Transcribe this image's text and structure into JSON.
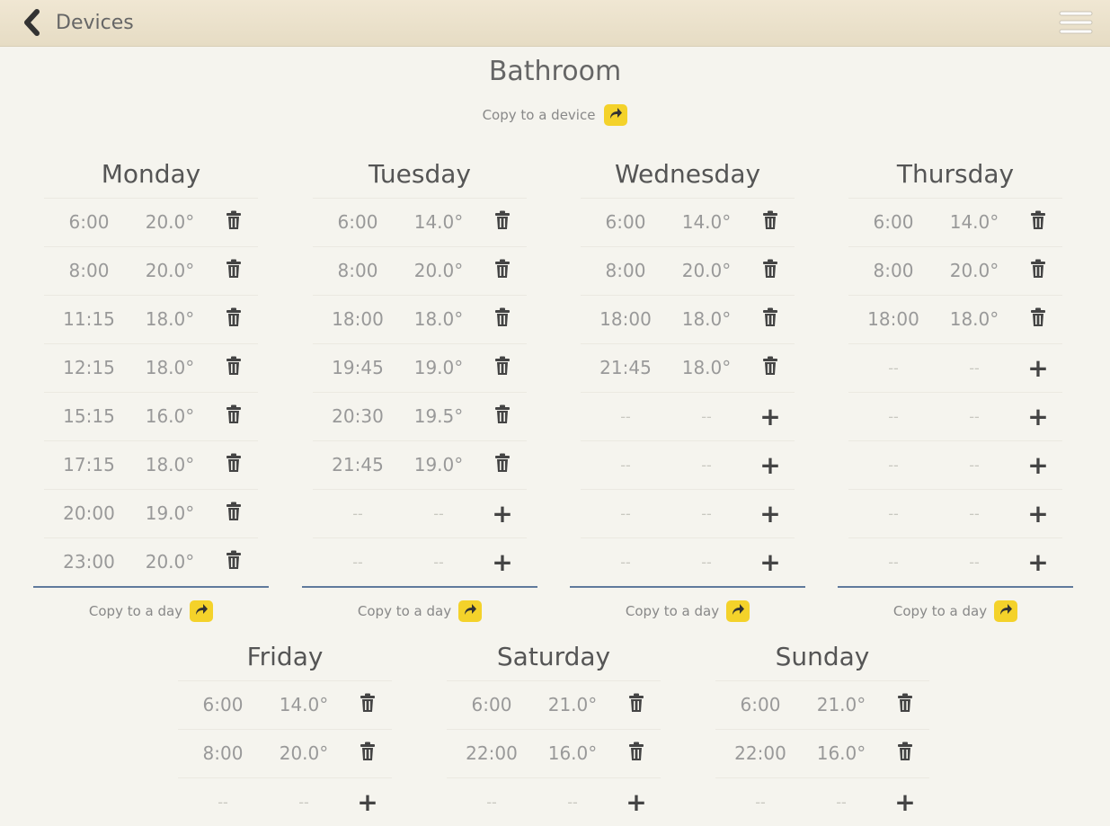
{
  "header": {
    "back_label": "Devices"
  },
  "device": {
    "title": "Bathroom",
    "copy_label": "Copy to a device"
  },
  "copy_day_label": "Copy to a day",
  "empty_placeholder": "--",
  "colors": {
    "accent": "#f4d22a",
    "underline": "#5f7a9c",
    "topbar": "#ece2cc"
  },
  "days": [
    {
      "name": "Monday",
      "slots": [
        {
          "time": "6:00",
          "temp": "20.0°"
        },
        {
          "time": "8:00",
          "temp": "20.0°"
        },
        {
          "time": "11:15",
          "temp": "18.0°"
        },
        {
          "time": "12:15",
          "temp": "18.0°"
        },
        {
          "time": "15:15",
          "temp": "16.0°"
        },
        {
          "time": "17:15",
          "temp": "18.0°"
        },
        {
          "time": "20:00",
          "temp": "19.0°"
        },
        {
          "time": "23:00",
          "temp": "20.0°"
        }
      ]
    },
    {
      "name": "Tuesday",
      "slots": [
        {
          "time": "6:00",
          "temp": "14.0°"
        },
        {
          "time": "8:00",
          "temp": "20.0°"
        },
        {
          "time": "18:00",
          "temp": "18.0°"
        },
        {
          "time": "19:45",
          "temp": "19.0°"
        },
        {
          "time": "20:30",
          "temp": "19.5°"
        },
        {
          "time": "21:45",
          "temp": "19.0°"
        },
        {
          "time": "--",
          "temp": "--"
        },
        {
          "time": "--",
          "temp": "--"
        }
      ]
    },
    {
      "name": "Wednesday",
      "slots": [
        {
          "time": "6:00",
          "temp": "14.0°"
        },
        {
          "time": "8:00",
          "temp": "20.0°"
        },
        {
          "time": "18:00",
          "temp": "18.0°"
        },
        {
          "time": "21:45",
          "temp": "18.0°"
        },
        {
          "time": "--",
          "temp": "--"
        },
        {
          "time": "--",
          "temp": "--"
        },
        {
          "time": "--",
          "temp": "--"
        },
        {
          "time": "--",
          "temp": "--"
        }
      ]
    },
    {
      "name": "Thursday",
      "slots": [
        {
          "time": "6:00",
          "temp": "14.0°"
        },
        {
          "time": "8:00",
          "temp": "20.0°"
        },
        {
          "time": "18:00",
          "temp": "18.0°"
        },
        {
          "time": "--",
          "temp": "--"
        },
        {
          "time": "--",
          "temp": "--"
        },
        {
          "time": "--",
          "temp": "--"
        },
        {
          "time": "--",
          "temp": "--"
        },
        {
          "time": "--",
          "temp": "--"
        }
      ]
    },
    {
      "name": "Friday",
      "slots": [
        {
          "time": "6:00",
          "temp": "14.0°"
        },
        {
          "time": "8:00",
          "temp": "20.0°"
        },
        {
          "time": "--",
          "temp": "--"
        }
      ]
    },
    {
      "name": "Saturday",
      "slots": [
        {
          "time": "6:00",
          "temp": "21.0°"
        },
        {
          "time": "22:00",
          "temp": "16.0°"
        },
        {
          "time": "--",
          "temp": "--"
        }
      ]
    },
    {
      "name": "Sunday",
      "slots": [
        {
          "time": "6:00",
          "temp": "21.0°"
        },
        {
          "time": "22:00",
          "temp": "16.0°"
        },
        {
          "time": "--",
          "temp": "--"
        }
      ]
    }
  ]
}
